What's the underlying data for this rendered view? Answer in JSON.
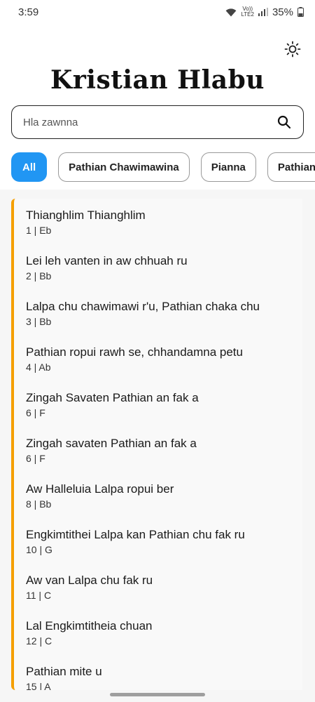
{
  "status_bar": {
    "time": "3:59",
    "volte_label": "Vo))\nLTE2",
    "battery": "35%"
  },
  "header": {
    "title": "Kristian Hlabu",
    "theme_icon": "sun-icon"
  },
  "search": {
    "placeholder": "Hla zawnna",
    "value": ""
  },
  "filters": [
    {
      "label": "All",
      "active": true
    },
    {
      "label": "Pathian Chawimawina",
      "active": false
    },
    {
      "label": "Pianna",
      "active": false
    },
    {
      "label": "Pathian",
      "active": false
    }
  ],
  "songs": [
    {
      "title": "Thianghlim Thianghlim",
      "meta": "1 | Eb"
    },
    {
      "title": "Lei leh vanten in aw chhuah ru",
      "meta": "2 | Bb"
    },
    {
      "title": "Lalpa chu chawimawi r'u, Pathian chaka chu",
      "meta": "3 | Bb"
    },
    {
      "title": "Pathian ropui rawh se, chhandamna petu",
      "meta": "4 | Ab"
    },
    {
      "title": "Zingah Savaten Pathian an fak a",
      "meta": "6 | F"
    },
    {
      "title": "Zingah savaten Pathian an fak a",
      "meta": "6 | F"
    },
    {
      "title": "Aw Halleluia Lalpa ropui ber",
      "meta": "8 | Bb"
    },
    {
      "title": "Engkimtithei Lalpa kan Pathian chu fak ru",
      "meta": "10 | G"
    },
    {
      "title": "Aw van Lalpa chu fak ru",
      "meta": "11 | C"
    },
    {
      "title": "Lal Engkimtitheia chuan",
      "meta": "12 | C"
    },
    {
      "title": "Pathian mite u",
      "meta": "15 | A"
    }
  ],
  "colors": {
    "accent": "#2196f3",
    "list_marker": "#f59f00"
  }
}
